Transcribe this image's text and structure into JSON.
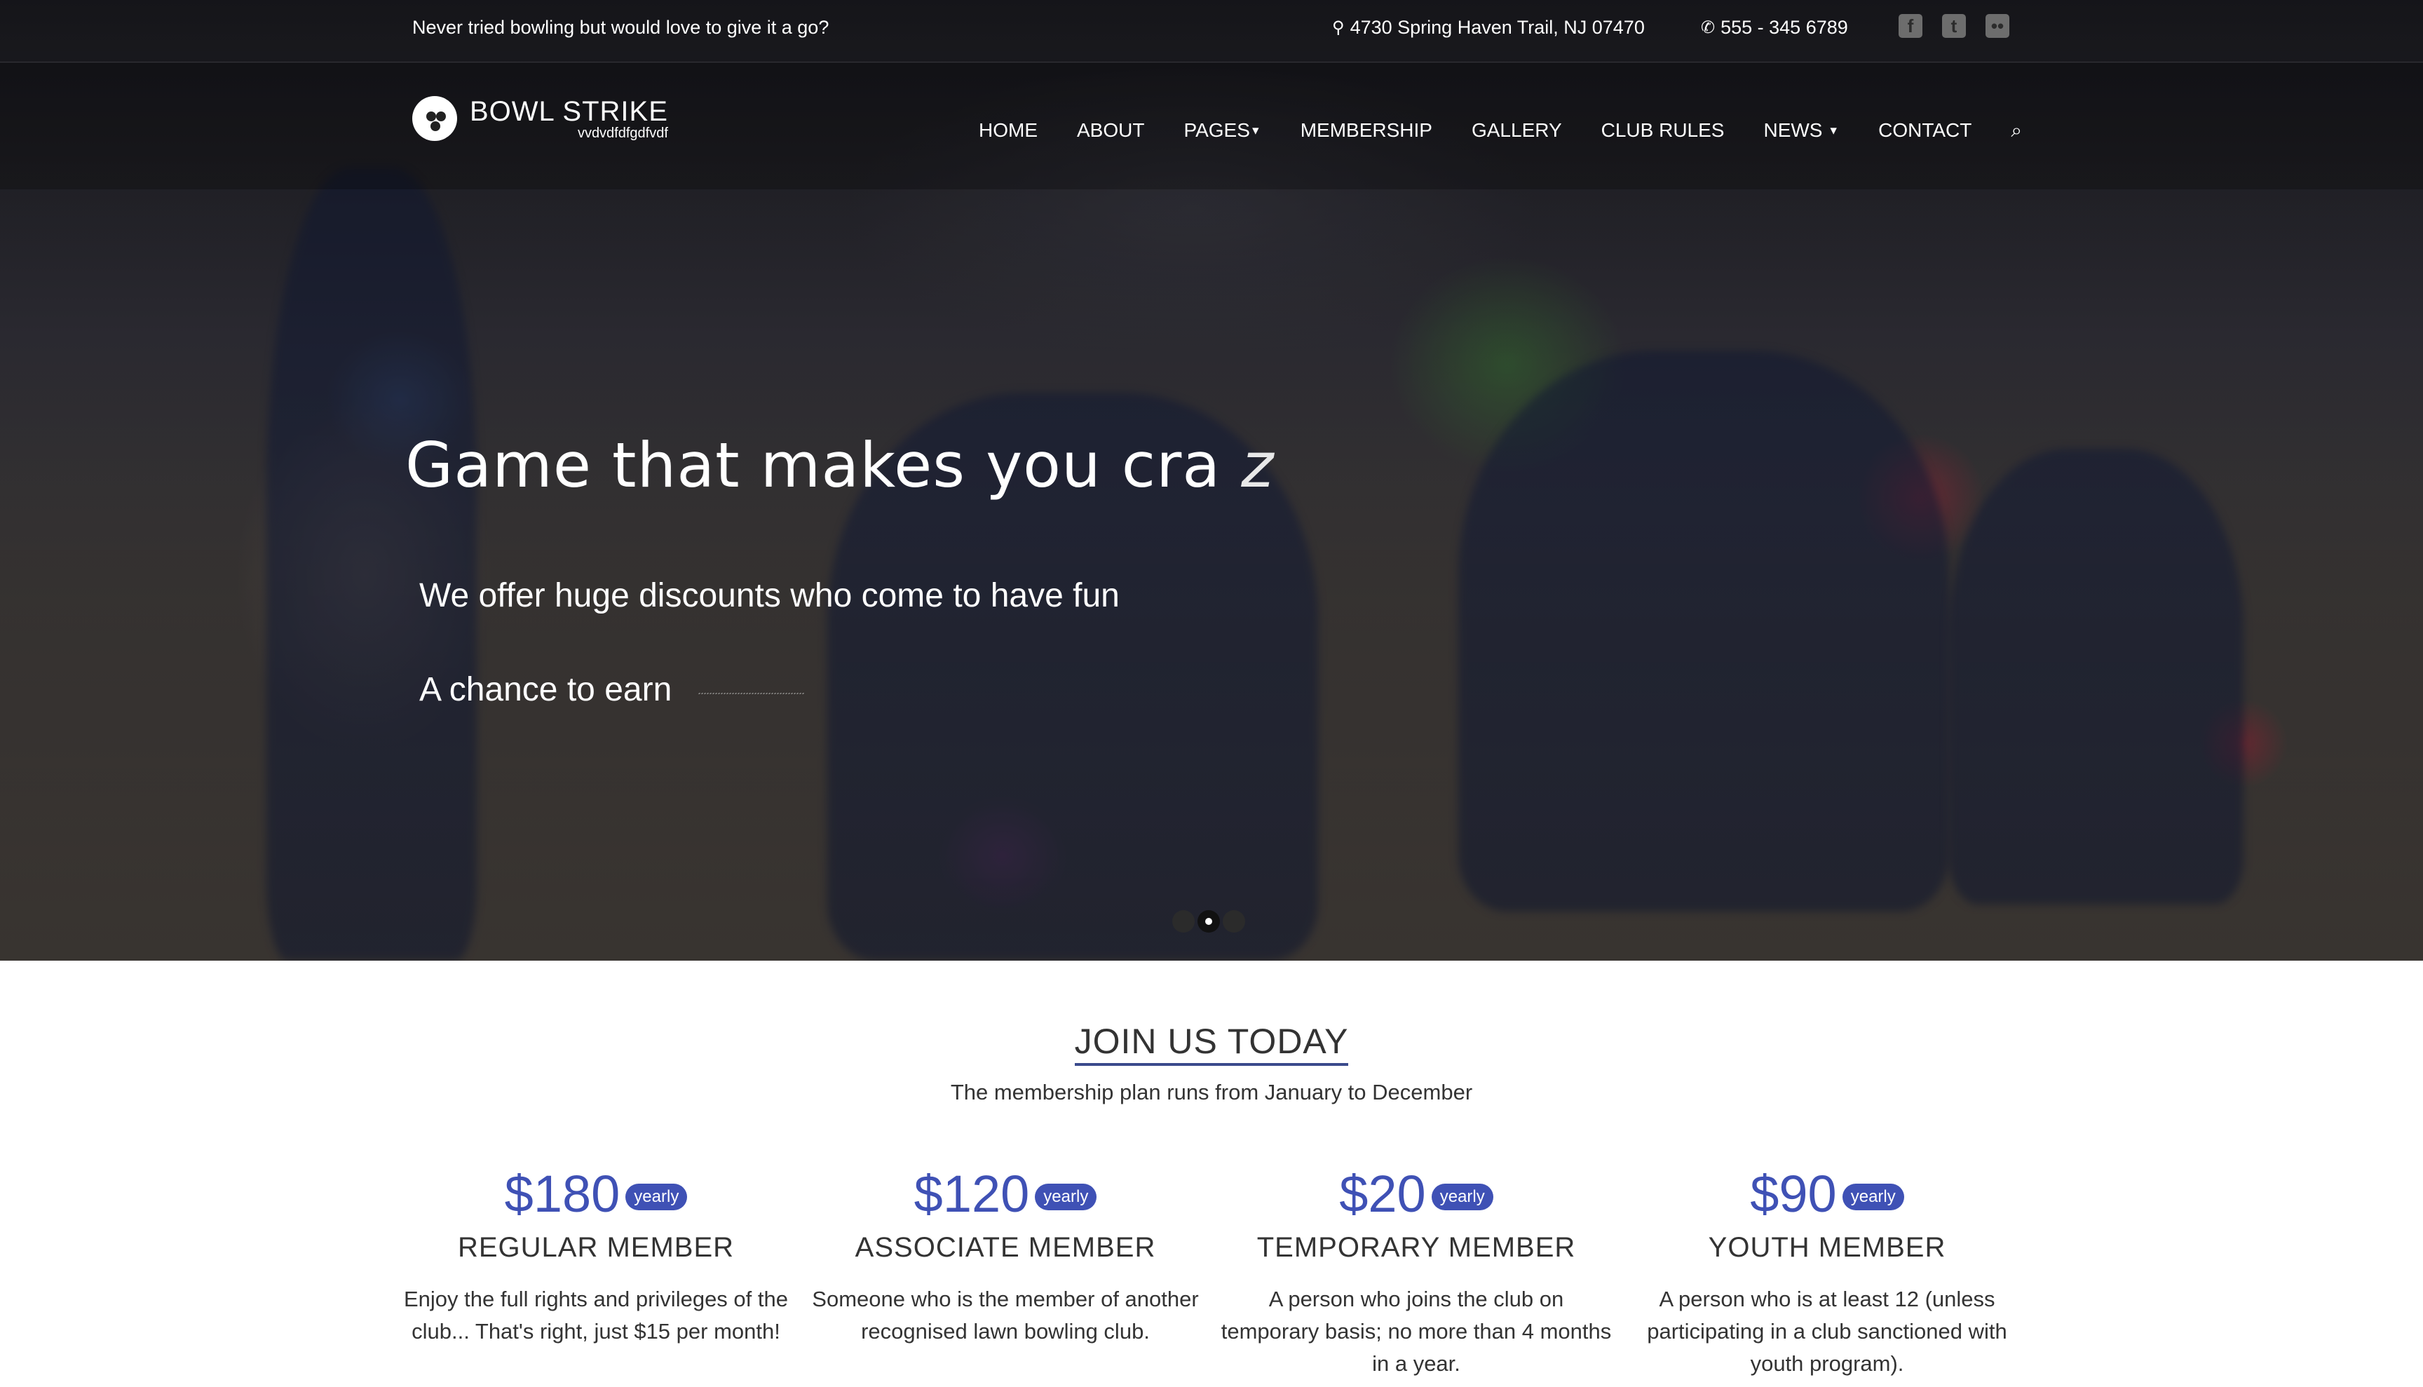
{
  "topbar": {
    "tagline": "Never tried bowling but would love to give it a go?",
    "address": "4730 Spring Haven Trail, NJ 07470",
    "phone": "555 - 345 6789",
    "social": [
      "facebook-icon",
      "twitter-icon",
      "flickr-icon"
    ]
  },
  "logo": {
    "name": "BOWL STRIKE",
    "subtitle": "vvdvdfdfgdfvdf"
  },
  "menu": {
    "home": "HOME",
    "about": "ABOUT",
    "pages": "PAGES",
    "membership": "MEMBERSHIP",
    "gallery": "GALLERY",
    "club_rules": "CLUB RULES",
    "news": "NEWS",
    "contact": "CONTACT"
  },
  "hero": {
    "headline": "Game that makes you cra",
    "headline_tail": "z",
    "line1": "We offer huge discounts who come to have fun",
    "line2": "A chance to earn",
    "active_slide": 2,
    "slide_count": 3
  },
  "membership": {
    "title": "JOIN US TODAY",
    "subtitle": "The membership plan runs from January to December",
    "plans": [
      {
        "price": "$180",
        "period": "yearly",
        "name": "REGULAR MEMBER",
        "desc": "Enjoy the full rights and privileges of the club... That's right, just $15 per month!"
      },
      {
        "price": "$120",
        "period": "yearly",
        "name": "ASSOCIATE MEMBER",
        "desc": "Someone who is the member of another recognised lawn bowling club."
      },
      {
        "price": "$20",
        "period": "yearly",
        "name": "TEMPORARY MEMBER",
        "desc": "A person who joins the club on temporary basis; no more than 4 months in a year."
      },
      {
        "price": "$90",
        "period": "yearly",
        "name": "YOUTH MEMBER",
        "desc": "A person who is at least 12 (unless participating in a club sanctioned with youth program)."
      }
    ]
  },
  "colors": {
    "accent": "#3f51b5",
    "title_underline": "#3a4a8c"
  }
}
